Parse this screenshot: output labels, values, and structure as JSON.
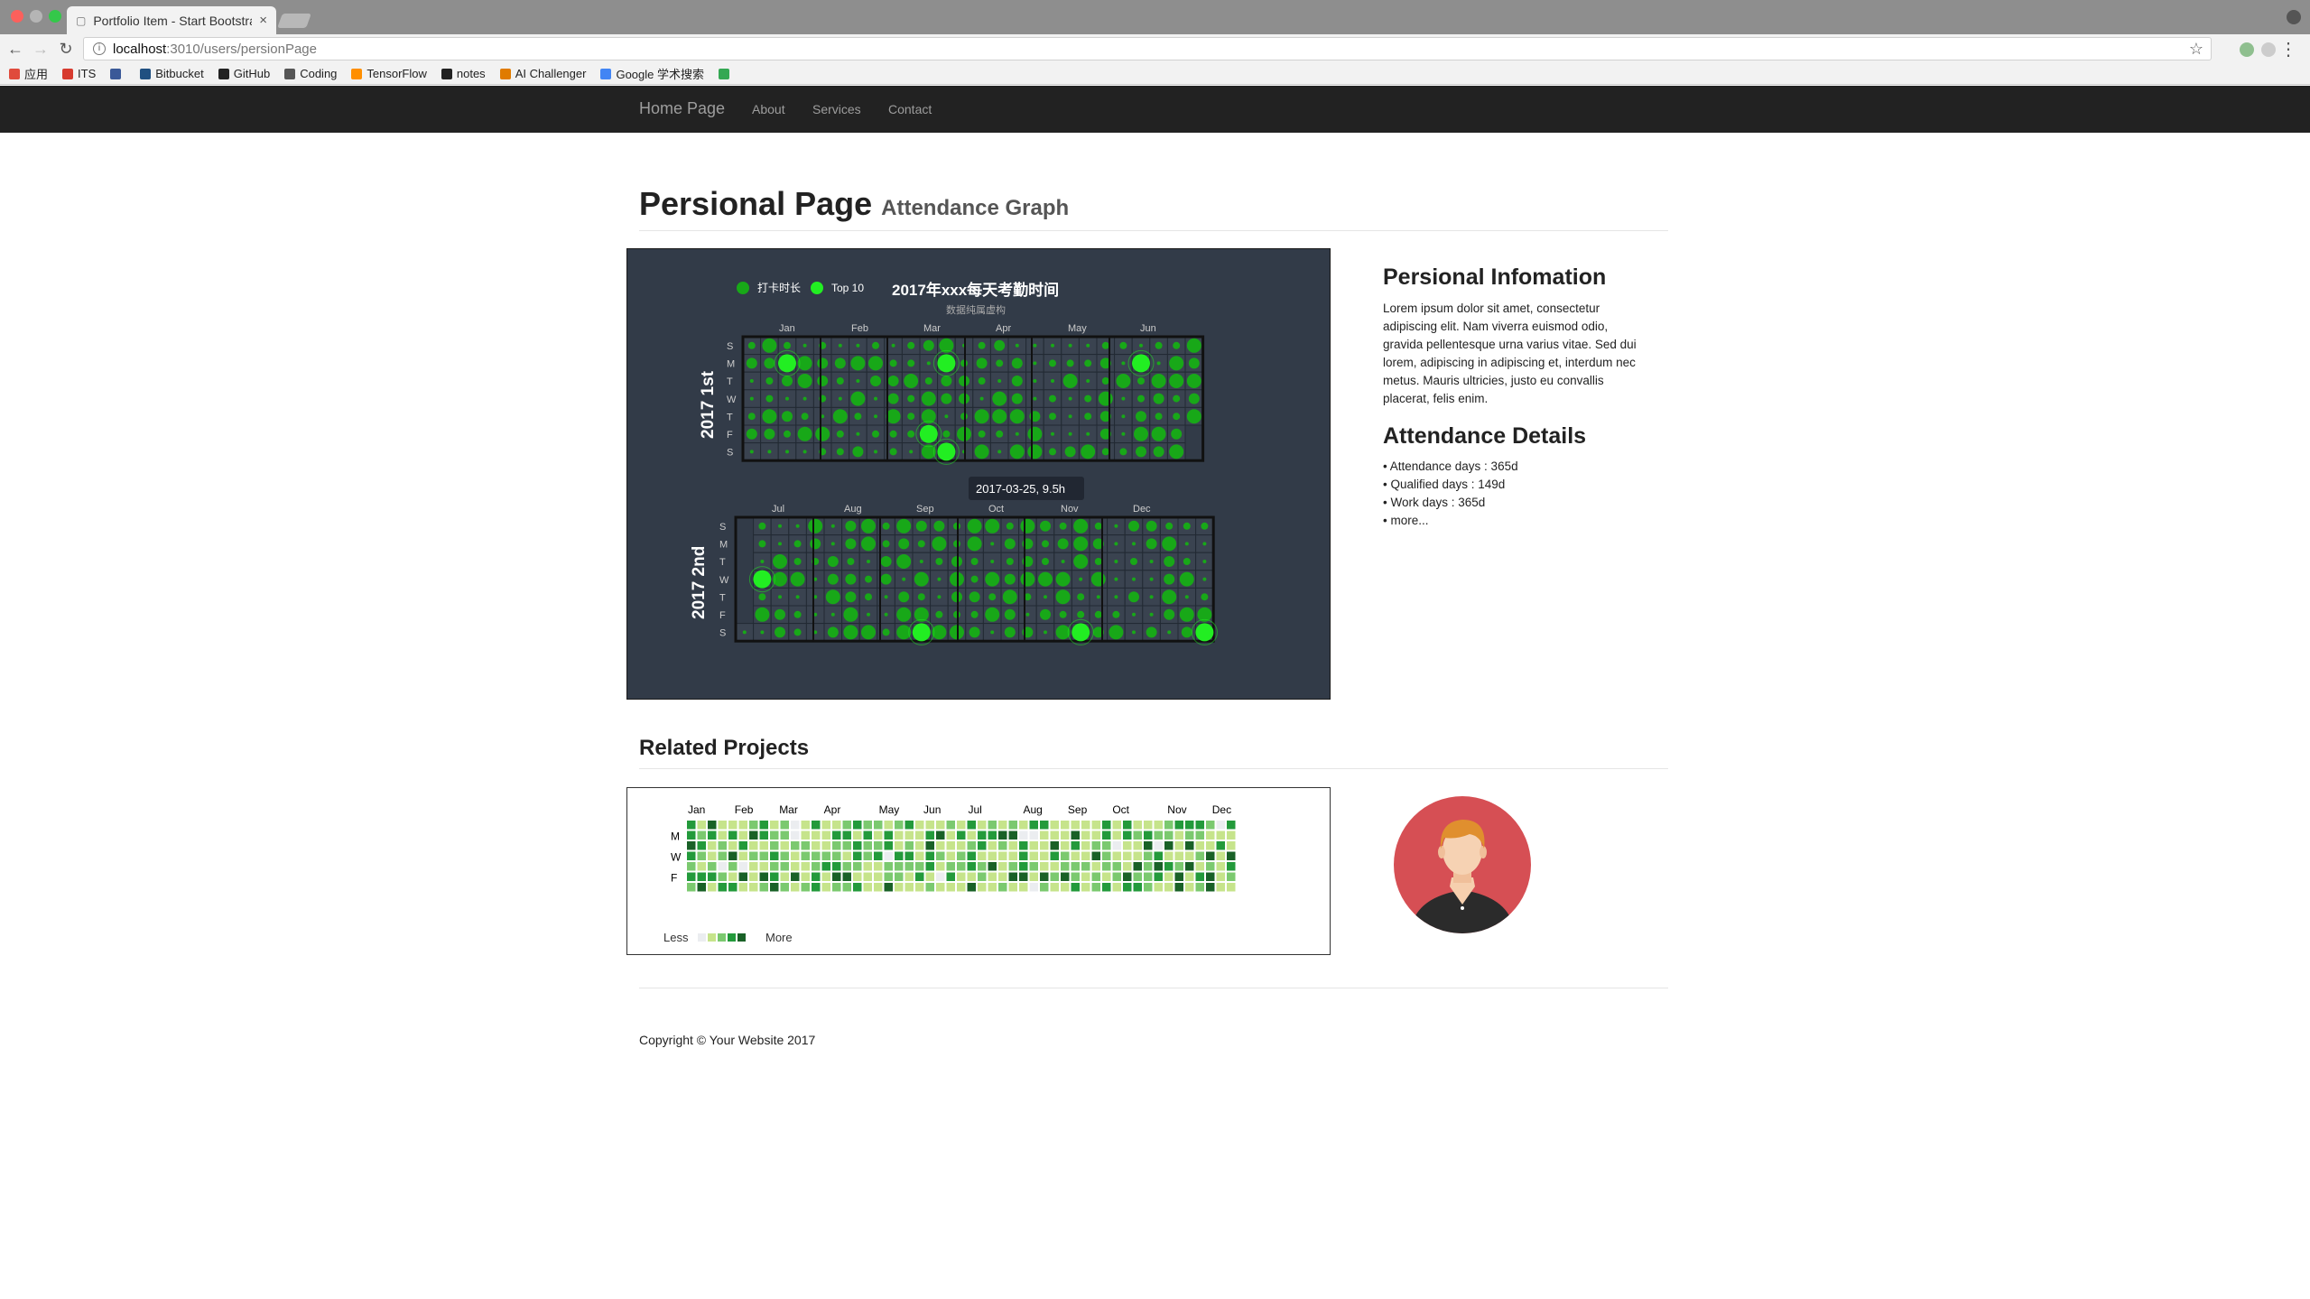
{
  "browser": {
    "tab_title": "Portfolio Item - Start Bootstrap",
    "tab_close": "×",
    "url_host": "localhost",
    "url_path": ":3010/users/persionPage",
    "bookmarks": [
      {
        "label": "应用",
        "color": "#e04b3c"
      },
      {
        "label": "ITS",
        "color": "#d73b2f"
      },
      {
        "label": "",
        "color": "#3b5998"
      },
      {
        "label": "Bitbucket",
        "color": "#205081"
      },
      {
        "label": "GitHub",
        "color": "#222222"
      },
      {
        "label": "Coding",
        "color": "#555555"
      },
      {
        "label": "TensorFlow",
        "color": "#ff8f00"
      },
      {
        "label": "notes",
        "color": "#222222"
      },
      {
        "label": "AI Challenger",
        "color": "#e07b00"
      },
      {
        "label": "Google 学术搜索",
        "color": "#4285f4"
      },
      {
        "label": "",
        "color": "#34a853"
      }
    ]
  },
  "nav": {
    "brand": "Home Page",
    "links": [
      "About",
      "Services",
      "Contact"
    ]
  },
  "header": {
    "title": "Persional Page",
    "subtitle": "Attendance Graph"
  },
  "attendance_chart": {
    "title": "2017年xxx每天考勤时间",
    "subtitle": "数据纯属虚构",
    "legend": [
      "打卡时长",
      "Top 10"
    ],
    "row_label_1": "2017  1st",
    "row_label_2": "2017  2nd",
    "months_1": [
      "Jan",
      "Feb",
      "Mar",
      "Apr",
      "May",
      "Jun"
    ],
    "months_2": [
      "Jul",
      "Aug",
      "Sep",
      "Oct",
      "Nov",
      "Dec"
    ],
    "days": [
      "S",
      "M",
      "T",
      "W",
      "T",
      "F",
      "S"
    ],
    "tooltip": "2017-03-25,  9.5h",
    "colors": {
      "bg": "#323b48",
      "cell": "#3a4350",
      "grid": "#111111",
      "dot": "#18a818",
      "top": "#22ee22"
    }
  },
  "sidebar": {
    "info_title": "Persional Infomation",
    "info_text": "Lorem ipsum dolor sit amet, consectetur adipiscing elit. Nam viverra euismod odio, gravida pellentesque urna varius vitae. Sed dui lorem, adipiscing in adipiscing et, interdum nec metus. Mauris ultricies, justo eu convallis placerat, felis enim.",
    "details_title": "Attendance Details",
    "details": [
      "Attendance days : 365d",
      "Qualified days : 149d",
      "Work days : 365d",
      "more..."
    ]
  },
  "related": {
    "title": "Related Projects",
    "months": [
      "Jan",
      "Feb",
      "Mar",
      "Apr",
      "May",
      "Jun",
      "Jul",
      "Aug",
      "Sep",
      "Oct",
      "Nov",
      "Dec"
    ],
    "days": [
      "M",
      "W",
      "F"
    ],
    "legend_less": "Less",
    "legend_more": "More",
    "palette": [
      "#ebedf0",
      "#c6e48b",
      "#7bc96f",
      "#239a3b",
      "#196127"
    ]
  },
  "footer": {
    "text": "Copyright © Your Website 2017"
  }
}
